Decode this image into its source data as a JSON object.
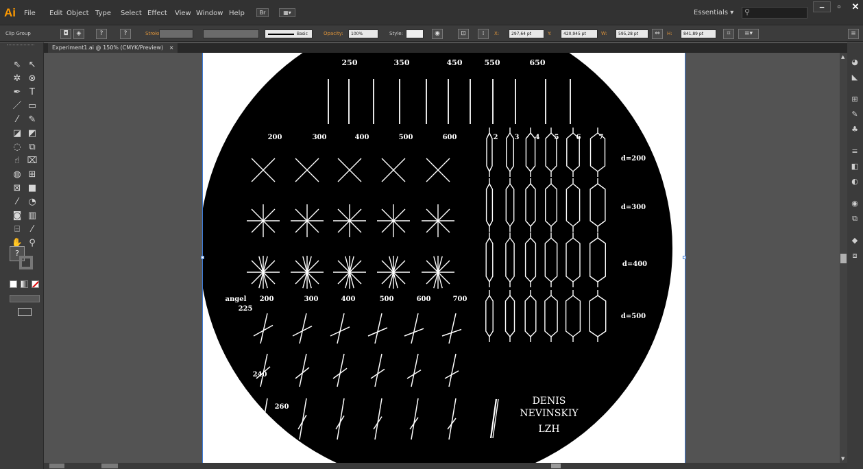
{
  "app": {
    "logo": "Ai"
  },
  "menu": [
    "File",
    "Edit",
    "Object",
    "Type",
    "Select",
    "Effect",
    "View",
    "Window",
    "Help"
  ],
  "menu_buttons": {
    "bridge": "Br",
    "arrange": "▦▾"
  },
  "workspace": {
    "label": "Essentials",
    "caret": "▾"
  },
  "window_buttons": {
    "minimize": "−",
    "restore": "▫",
    "close": "✕"
  },
  "control": {
    "selection": "Clip Group",
    "stroke_label": "Stroke:",
    "brush": "Basic",
    "opacity_label": "Opacity:",
    "opacity": "100%",
    "style_label": "Style:",
    "x_label": "X:",
    "x": "297,64 pt",
    "y_label": "Y:",
    "y": "420,945 pt",
    "w_label": "W:",
    "w": "595,28 pt",
    "h_label": "H:",
    "h": "841,89 pt",
    "question": "?"
  },
  "document": {
    "tab": "Experiment1.ai @ 150% (CMYK/Preview)",
    "close": "×"
  },
  "colors": {
    "accent": "#ff9a00",
    "artboard_edge": "#3e7bd6",
    "disc": "#000000",
    "ink": "#ffffff"
  },
  "artwork": {
    "top_labels": [
      "250",
      "350",
      "450",
      "550",
      "650"
    ],
    "cross_labels": [
      "200",
      "300",
      "400",
      "500",
      "600"
    ],
    "cell_counts": [
      "2",
      "3",
      "4",
      "5",
      "6",
      "7"
    ],
    "d_labels": [
      "d=200",
      "d=300",
      "d=400",
      "d=500"
    ],
    "angle_word": "angel",
    "angle_cols": [
      "200",
      "300",
      "400",
      "500",
      "600",
      "700"
    ],
    "angle_rows": [
      "225",
      "240",
      "260"
    ],
    "signature": [
      "DENIS",
      "NEVINSKIY",
      "LZH"
    ]
  },
  "tool_icons": [
    "selection-icon",
    "direct-selection-icon",
    "magic-wand-icon",
    "lasso-icon",
    "pen-icon",
    "type-icon",
    "line-icon",
    "rectangle-icon",
    "paintbrush-icon",
    "pencil-icon",
    "blob-brush-icon",
    "eraser-icon",
    "rotate-icon",
    "scale-icon",
    "warp-icon",
    "free-transform-icon",
    "shape-builder-icon",
    "perspective-grid-icon",
    "mesh-icon",
    "gradient-icon",
    "eyedropper-icon",
    "blend-icon",
    "symbol-sprayer-icon",
    "column-graph-icon",
    "artboard-icon",
    "slice-icon",
    "hand-icon",
    "zoom-icon"
  ]
}
